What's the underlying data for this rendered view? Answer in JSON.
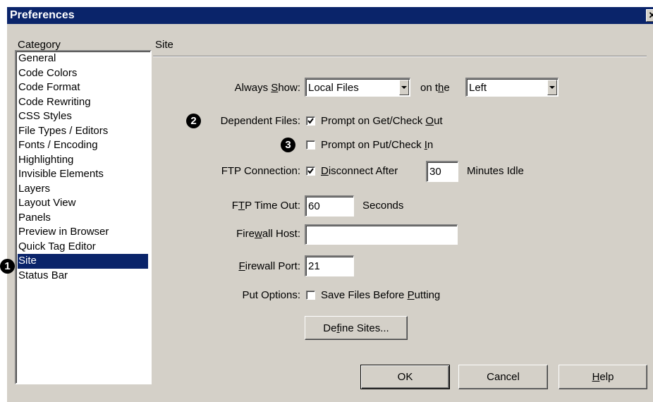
{
  "window": {
    "title": "Preferences",
    "close_glyph": "✕"
  },
  "category": {
    "heading": "Category",
    "items": [
      {
        "label": "General"
      },
      {
        "label": "Code Colors"
      },
      {
        "label": "Code Format"
      },
      {
        "label": "Code Rewriting"
      },
      {
        "label": "CSS Styles"
      },
      {
        "label": "File Types / Editors"
      },
      {
        "label": "Fonts / Encoding"
      },
      {
        "label": "Highlighting"
      },
      {
        "label": "Invisible Elements"
      },
      {
        "label": "Layers"
      },
      {
        "label": "Layout View"
      },
      {
        "label": "Panels"
      },
      {
        "label": "Preview in Browser"
      },
      {
        "label": "Quick Tag Editor"
      },
      {
        "label": "Site"
      },
      {
        "label": "Status Bar"
      }
    ],
    "selected": "Site"
  },
  "site": {
    "heading": "Site",
    "always_show": {
      "label_pre": "Always ",
      "label_key": "S",
      "label_post": "how:",
      "value": "Local Files",
      "on_the_pre": "on t",
      "on_the_key": "h",
      "on_the_post": "e",
      "side_value": "Left"
    },
    "dependent_files": {
      "label": "Dependent Files:",
      "get_checkout": {
        "checked": true,
        "pre": "Prompt on Get/Check ",
        "key": "O",
        "post": "ut"
      },
      "put_checkin": {
        "checked": false,
        "pre": "Prompt on Put/Check ",
        "key": "I",
        "post": "n"
      }
    },
    "ftp_connection": {
      "label": "FTP Connection:",
      "checked": true,
      "pre": "",
      "key": "D",
      "post": "isconnect After",
      "minutes": "30",
      "minutes_suffix": "Minutes Idle"
    },
    "ftp_timeout": {
      "pre": "F",
      "key": "T",
      "post": "P Time Out:",
      "value": "60",
      "suffix": "Seconds"
    },
    "firewall_host": {
      "pre": "Fire",
      "key": "w",
      "post": "all Host:",
      "value": ""
    },
    "firewall_port": {
      "pre": "",
      "key": "F",
      "post": "irewall Port:",
      "value": "21"
    },
    "put_options": {
      "label": "Put Options:",
      "checked": false,
      "pre": "Save Files Before ",
      "key": "P",
      "post": "utting"
    },
    "define_sites": {
      "pre": "De",
      "key": "f",
      "post": "ine Sites..."
    }
  },
  "buttons": {
    "ok": "OK",
    "cancel": "Cancel",
    "help_key": "H",
    "help_post": "elp"
  },
  "callouts": {
    "one": "1",
    "two": "2",
    "three": "3"
  }
}
